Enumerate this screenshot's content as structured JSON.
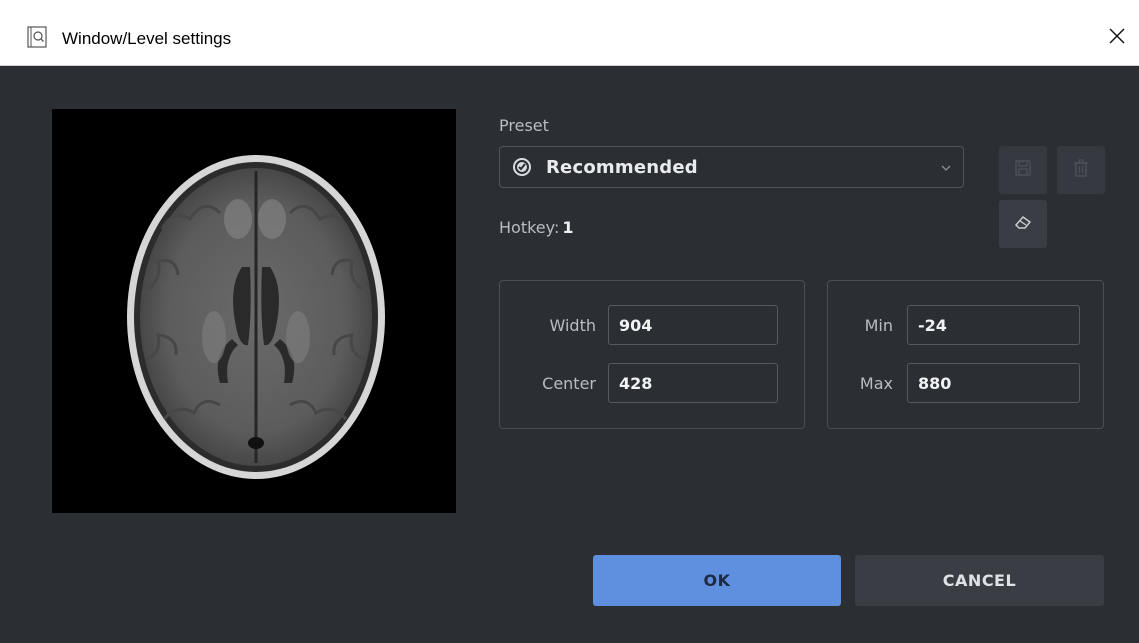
{
  "window": {
    "title": "Window/Level settings",
    "icons": {
      "app": "window-level-app-icon",
      "close": "close-icon"
    }
  },
  "preview": {
    "image": "brain-mri-axial-slice"
  },
  "preset": {
    "label": "Preset",
    "selected": "Recommended",
    "selected_icon": "recommended-badge-icon",
    "hotkey_label": "Hotkey:",
    "hotkey_value": "1",
    "actions": [
      "save-preset-icon",
      "delete-preset-icon",
      "reset-eraser-icon"
    ]
  },
  "fields": {
    "width": {
      "label": "Width",
      "value": "904"
    },
    "center": {
      "label": "Center",
      "value": "428"
    },
    "min": {
      "label": "Min",
      "value": "-24"
    },
    "max": {
      "label": "Max",
      "value": "880"
    }
  },
  "buttons": {
    "ok": "OK",
    "cancel": "CANCEL"
  },
  "colors": {
    "background": "#2b2e33",
    "accent": "#5f90e0",
    "secondary_button": "#3a3e44",
    "titlebar": "#ffffff"
  }
}
